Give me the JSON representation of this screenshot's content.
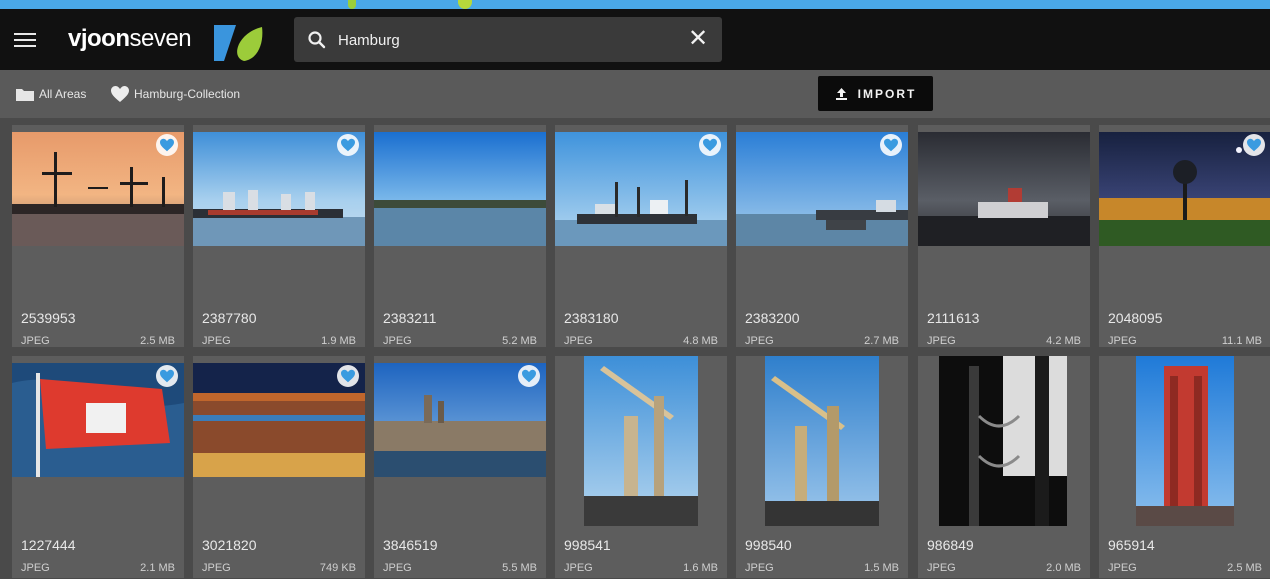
{
  "app": {
    "logo_text_bold": "vjoon",
    "logo_text_light": "seven"
  },
  "colors": {
    "accent": "#4aa8e8",
    "heart": "#3a9be0",
    "header_bg": "#111111"
  },
  "search": {
    "value": "Hamburg",
    "placeholder": "Search",
    "clear_label": "✕"
  },
  "breadcrumbs": [
    {
      "label": "All Areas",
      "icon": "folder-icon"
    },
    {
      "label": "Hamburg-Collection",
      "icon": "heart-icon"
    }
  ],
  "toolbar": {
    "import_label": "IMPORT"
  },
  "assets": [
    {
      "id": "2539953",
      "format": "JPEG",
      "size": "2.5 MB",
      "favorite": true
    },
    {
      "id": "2387780",
      "format": "JPEG",
      "size": "1.9 MB",
      "favorite": true
    },
    {
      "id": "2383211",
      "format": "JPEG",
      "size": "5.2 MB",
      "favorite": false
    },
    {
      "id": "2383180",
      "format": "JPEG",
      "size": "4.8 MB",
      "favorite": true
    },
    {
      "id": "2383200",
      "format": "JPEG",
      "size": "2.7 MB",
      "favorite": true
    },
    {
      "id": "2111613",
      "format": "JPEG",
      "size": "4.2 MB",
      "favorite": false
    },
    {
      "id": "2048095",
      "format": "JPEG",
      "size": "11.1 MB",
      "favorite": true
    },
    {
      "id": "1227444",
      "format": "JPEG",
      "size": "2.1 MB",
      "favorite": true
    },
    {
      "id": "3021820",
      "format": "JPEG",
      "size": "749 KB",
      "favorite": true
    },
    {
      "id": "3846519",
      "format": "JPEG",
      "size": "5.5 MB",
      "favorite": true
    },
    {
      "id": "998541",
      "format": "JPEG",
      "size": "1.6 MB",
      "favorite": false
    },
    {
      "id": "998540",
      "format": "JPEG",
      "size": "1.5 MB",
      "favorite": false
    },
    {
      "id": "986849",
      "format": "JPEG",
      "size": "2.0 MB",
      "favorite": false
    },
    {
      "id": "965914",
      "format": "JPEG",
      "size": "2.5 MB",
      "favorite": false
    }
  ]
}
